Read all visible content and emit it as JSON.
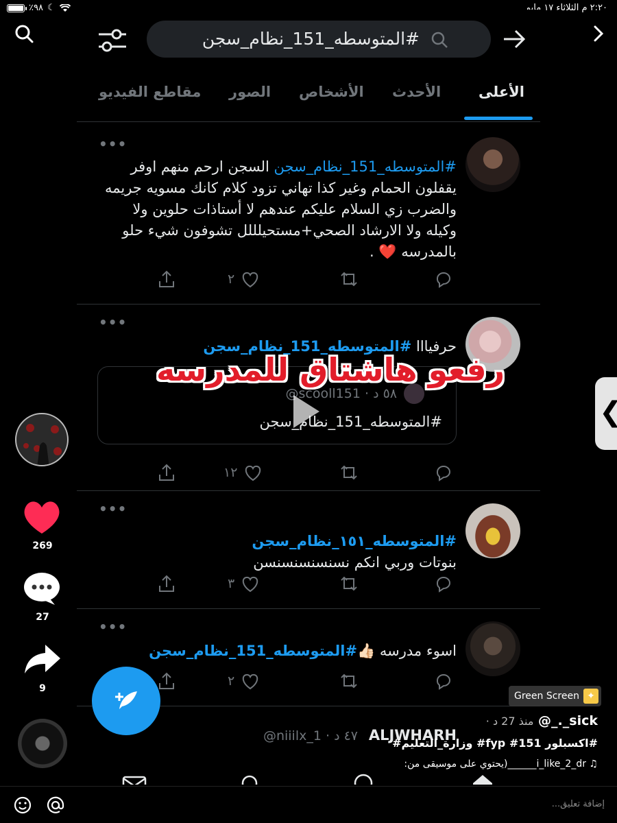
{
  "status_bar": {
    "battery": "٪٩٨",
    "battery_level": 0.98,
    "datetime": "٢:٢٠ م   الثلاثاء ١٧ مايو"
  },
  "twitter": {
    "search_query": "#المتوسطه_151_نظام_سجن",
    "tabs": [
      "الأعلى",
      "الأحدث",
      "الأشخاص",
      "الصور",
      "مقاطع الفيديو"
    ],
    "active_tab": "الأعلى",
    "tweets": [
      {
        "more": "•••",
        "hashtag": "#المتوسطه_151_نظام_سجن",
        "text": " السجن ارحم منهم اوفر يقفلون الحمام وغير كذا تهاني تزود كلام كانك مسويه جريمه والضرب زي السلام عليكم عندهم لا أستاذات حلوين ولا وكيله ولا الارشاد الصحي+مستحيلللل تشوفون شيء حلو بالمدرسه",
        "emoji": "❤️",
        "likes": "٢"
      },
      {
        "more": "•••",
        "text_prefix": "حرفيااا ",
        "hashtag": "#المتوسطه_151_نظام_سجن",
        "quote_handle": "@scooll151 · ٥٨ د",
        "quote_text": "#المتوسطه_151_نظام_سجن",
        "likes": "١٢"
      },
      {
        "more": "•••",
        "hashtag": "#المتوسطه_١٥١_نظام_سجن",
        "text": "بنوتات وربي انكم نسنسنسنسنسن",
        "likes": "٣"
      },
      {
        "more": "•••",
        "text_prefix": "اسوء مدرسه ",
        "emoji": "👍🏻",
        "hashtag": "#المتوسطه_151_نظام_سجن",
        "likes": "٢"
      }
    ],
    "last_tweet": {
      "name": "ALJWHARH",
      "meta": "@niiilx_1 · ٤٧ د"
    }
  },
  "overlay_caption": "رفعو هاشتاق للمدرسه",
  "tiktok": {
    "likes": "269",
    "comments": "27",
    "shares": "9",
    "green_screen": "Green Screen",
    "username": "@_._sick",
    "ago": "· منذ 27 د",
    "tags": "#اكسبلور 151# fyp# وزارة_التعليم#",
    "music": "♫ i_like_2_dr______(يحتوي على موسيقى من:",
    "comment_placeholder": "إضافة تعليق..."
  },
  "colors": {
    "twitter_blue": "#1d9bf0",
    "like_red": "#fe2c55",
    "overlay_red": "#e21d2a"
  }
}
